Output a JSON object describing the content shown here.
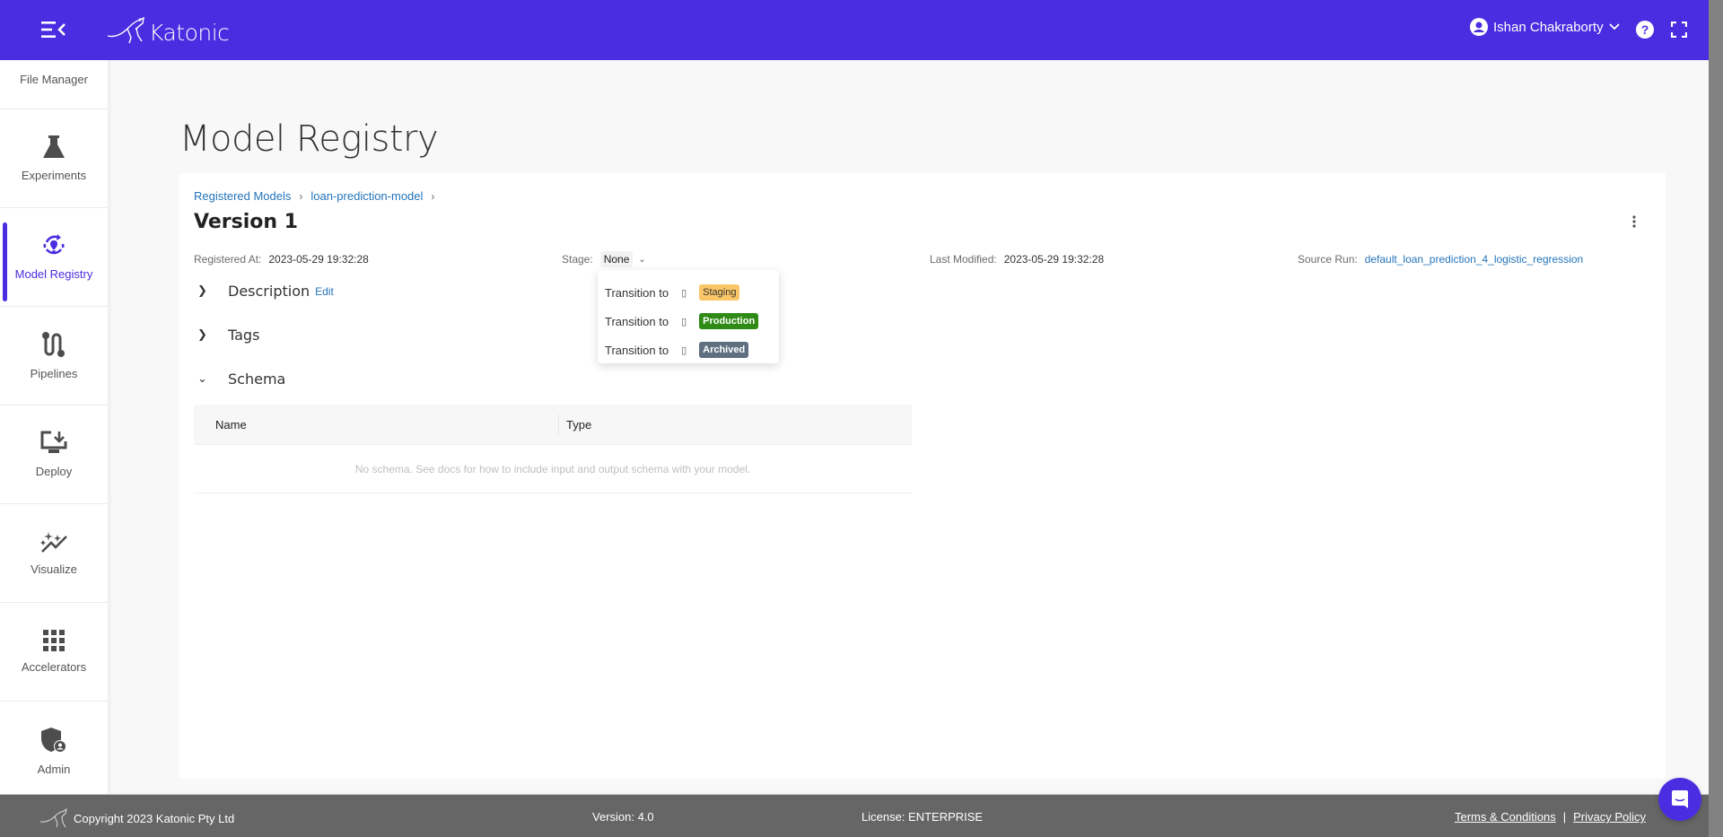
{
  "header": {
    "brand": "Katonic",
    "user_name": "Ishan Chakraborty",
    "accent_color": "#4a2de1"
  },
  "sidebar": {
    "items": [
      {
        "label": "File Manager",
        "icon": "folder-icon"
      },
      {
        "label": "Experiments",
        "icon": "flask-icon"
      },
      {
        "label": "Model Registry",
        "icon": "model-registry-icon",
        "active": true
      },
      {
        "label": "Pipelines",
        "icon": "pipeline-icon"
      },
      {
        "label": "Deploy",
        "icon": "monitor-download-icon"
      },
      {
        "label": "Visualize",
        "icon": "sparkle-chart-icon"
      },
      {
        "label": "Accelerators",
        "icon": "grid-icon"
      },
      {
        "label": "Admin",
        "icon": "shield-user-icon"
      }
    ]
  },
  "main": {
    "page_title": "Model Registry",
    "breadcrumb": [
      "Registered Models",
      "loan-prediction-model"
    ],
    "version_title": "Version 1",
    "meta": {
      "registered_label": "Registered At:",
      "registered_value": "2023-05-29 19:32:28",
      "stage_label": "Stage:",
      "stage_value": "None",
      "modified_label": "Last Modified:",
      "modified_value": "2023-05-29 19:32:28",
      "source_label": "Source Run:",
      "source_value": "default_loan_prediction_4_logistic_regression"
    },
    "sections": {
      "description": "Description",
      "edit": "Edit",
      "tags": "Tags",
      "schema": "Schema"
    },
    "schema_table": {
      "columns": [
        "Name",
        "Type"
      ],
      "empty_text": "No schema. See docs for how to include input and output schema with your model."
    }
  },
  "stage_dropdown": {
    "items": [
      {
        "label": "Transition to",
        "badge": "Staging",
        "color": "#fbc667"
      },
      {
        "label": "Transition to",
        "badge": "Production",
        "color": "#2f8a16"
      },
      {
        "label": "Transition to",
        "badge": "Archived",
        "color": "#5f6f7f"
      }
    ]
  },
  "footer": {
    "copyright": "Copyright 2023 Katonic Pty Ltd",
    "version": "Version: 4.0",
    "license": "License: ENTERPRISE",
    "terms": "Terms & Conditions",
    "separator": "|",
    "privacy": "Privacy Policy"
  }
}
